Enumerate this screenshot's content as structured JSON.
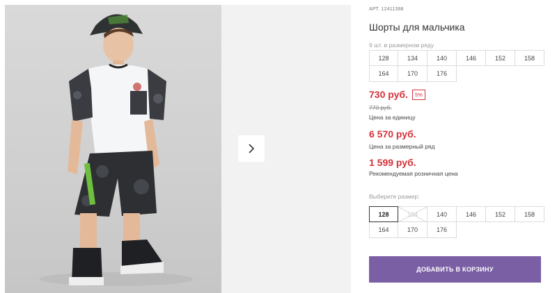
{
  "product": {
    "sku_label": "АРТ. 12411398",
    "title": "Шорты для мальчика",
    "set_note": "9 шт. в размерном ряду",
    "set_sizes": [
      "128",
      "134",
      "140",
      "146",
      "152",
      "158",
      "164",
      "170",
      "176"
    ]
  },
  "pricing": {
    "unit_price": "730 руб.",
    "discount": "5%",
    "old_price": "770 руб.",
    "unit_caption": "Цена за единицу",
    "set_price": "6 570 руб.",
    "set_caption": "Цена за размерный ряд",
    "retail_price": "1 599 руб.",
    "retail_caption": "Рекомендуемая розничная цена",
    "accent_color": "#d3303a"
  },
  "size_picker": {
    "label": "Выберите размер:",
    "sizes": [
      {
        "label": "128",
        "state": "selected"
      },
      {
        "label": "134",
        "state": "unavailable"
      },
      {
        "label": "140",
        "state": "available"
      },
      {
        "label": "146",
        "state": "available"
      },
      {
        "label": "152",
        "state": "available"
      },
      {
        "label": "158",
        "state": "available"
      },
      {
        "label": "164",
        "state": "available"
      },
      {
        "label": "170",
        "state": "available"
      },
      {
        "label": "176",
        "state": "available"
      }
    ]
  },
  "cart_button": {
    "label": "ДОБАВИТЬ В КОРЗИНУ",
    "color": "#7b5fa5"
  },
  "gallery": {
    "next_icon": "chevron-right-icon",
    "photo_subject": "product-photo"
  }
}
